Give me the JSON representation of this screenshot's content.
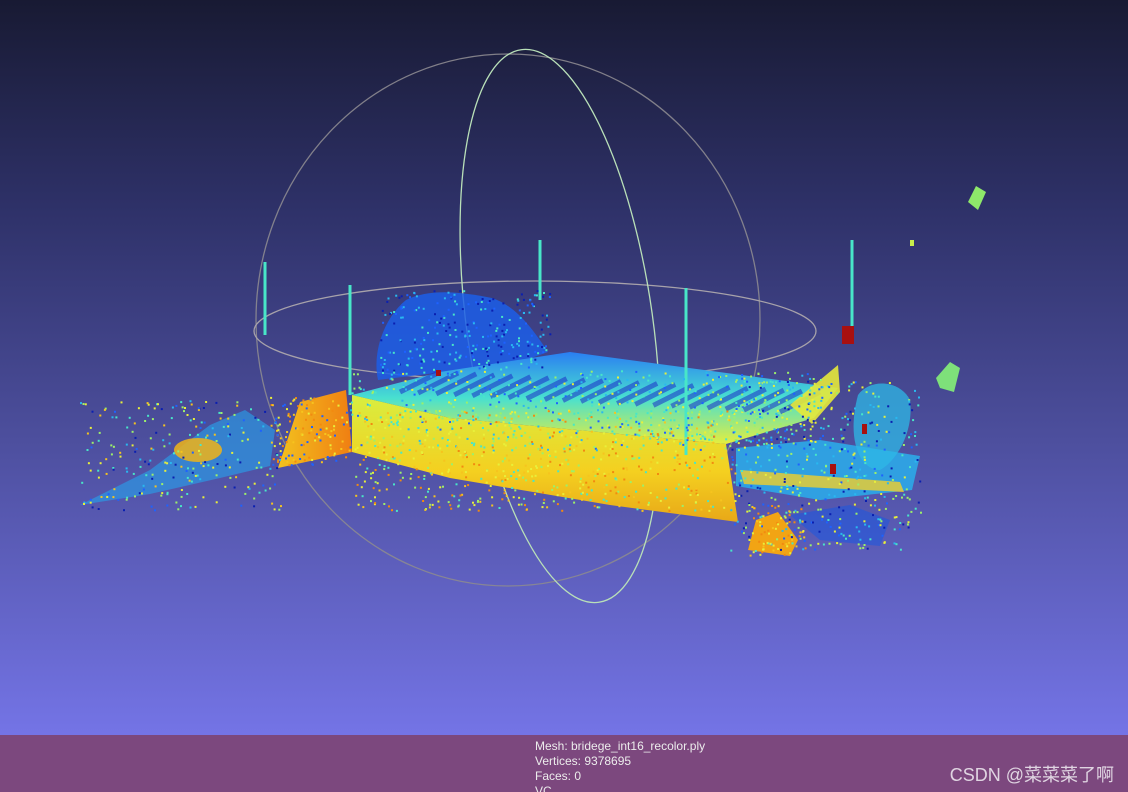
{
  "mesh_info": {
    "mesh": "Mesh: bridege_int16_recolor.ply",
    "vertices": "Vertices: 9378695",
    "faces": "Faces: 0",
    "vc": "VC"
  },
  "watermark": "CSDN @菜菜菜了啊",
  "colors": {
    "info_bar": "#7c487e",
    "background_top": "#181a33",
    "background_bottom": "#7474e6",
    "colormap": [
      "#0a1fb0",
      "#1e62ff",
      "#29b8f0",
      "#48e6c8",
      "#9cf06a",
      "#e8f03a",
      "#f6c41e",
      "#f28a10",
      "#a81010"
    ]
  },
  "icons": {
    "trackball": "trackball-sphere-icon"
  }
}
